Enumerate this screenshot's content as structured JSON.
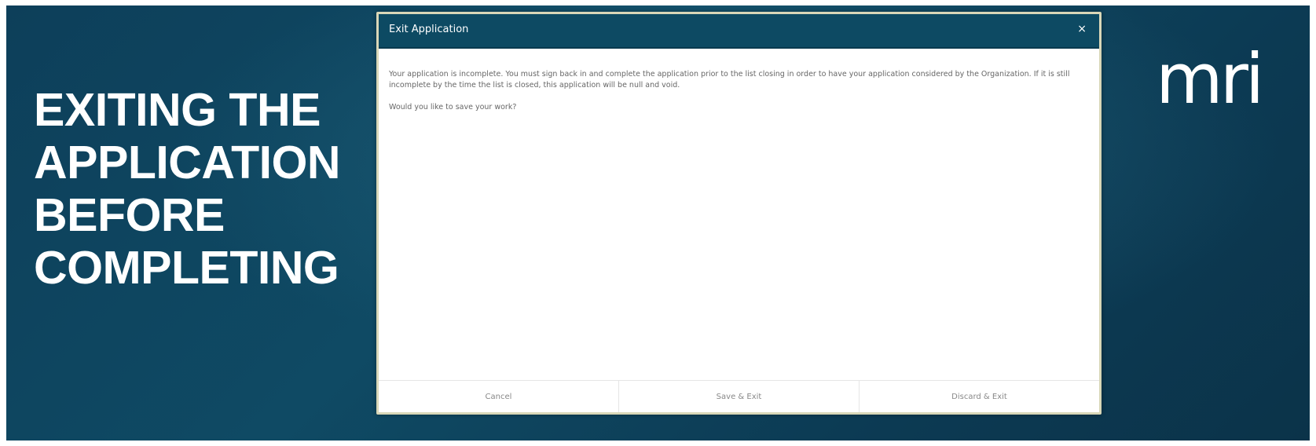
{
  "slide": {
    "title_lines": [
      "EXITING THE",
      "APPLICATION",
      "BEFORE",
      "COMPLETING"
    ],
    "logo_text": "mri"
  },
  "dialog": {
    "title": "Exit Application",
    "close_glyph": "×",
    "close_icon": "close-icon",
    "message": "Your application is incomplete. You must sign back in and complete the application prior to the list closing in order to have your application considered by the Organization. If it is still incomplete by the time the list is closed, this application will be null and void.",
    "question": "Would you like to save your work?",
    "buttons": {
      "cancel": "Cancel",
      "save_exit": "Save & Exit",
      "discard_exit": "Discard & Exit"
    }
  },
  "colors": {
    "background": "#0d3f5a",
    "dialog_header": "#0d4a63",
    "dialog_border": "#d9d7b8"
  }
}
